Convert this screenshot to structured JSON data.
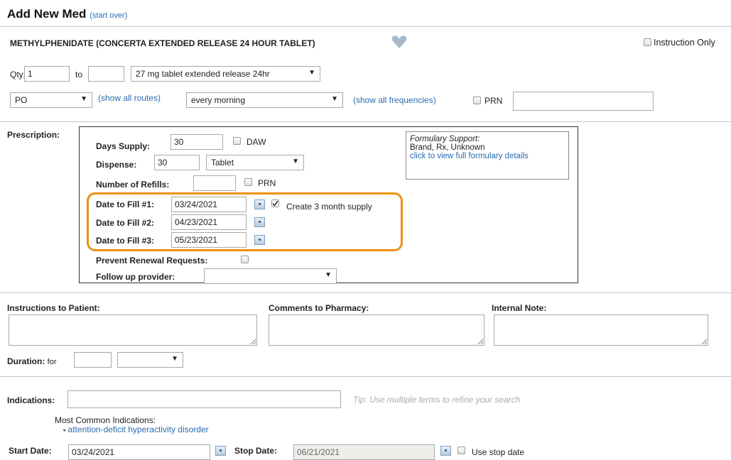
{
  "header": {
    "title": "Add New Med",
    "start_over": "(start over)"
  },
  "med": {
    "name": "METHYLPHENIDATE (CONCERTA EXTENDED RELEASE 24 HOUR TABLET)",
    "instruction_only": "Instruction Only"
  },
  "qty": {
    "label": "Qty:",
    "from": "1",
    "to_label": "to",
    "to": "",
    "form": "27 mg tablet extended release 24hr"
  },
  "route": {
    "value": "PO",
    "show_all_routes": "(show all routes)",
    "frequency": "every morning",
    "show_all_frequencies": "(show all frequencies)",
    "prn": "PRN",
    "prn_text": ""
  },
  "prescription": {
    "label": "Prescription:",
    "days_supply_label": "Days Supply:",
    "days_supply": "30",
    "daw": "DAW",
    "dispense_label": "Dispense:",
    "dispense": "30",
    "dispense_unit": "Tablet",
    "refills_label": "Number of Refills:",
    "refills": "",
    "prn": "PRN",
    "fill1_label": "Date to Fill #1:",
    "fill1": "03/24/2021",
    "fill2_label": "Date to Fill #2:",
    "fill2": "04/23/2021",
    "fill3_label": "Date to Fill #3:",
    "fill3": "05/23/2021",
    "three_month": "Create 3 month supply",
    "prevent_renewal": "Prevent Renewal Requests:",
    "follow_up": "Follow up provider:",
    "follow_up_value": ""
  },
  "formulary": {
    "title": "Formulary Support:",
    "info": "Brand, Rx, Unknown",
    "link": "click to view full formulary details"
  },
  "notes": {
    "instructions": "Instructions to Patient:",
    "comments": "Comments to Pharmacy:",
    "internal": "Internal Note:"
  },
  "duration": {
    "label": "Duration:",
    "for": "for",
    "value": "",
    "unit": ""
  },
  "indications": {
    "label": "Indications:",
    "value": "",
    "tip": "Tip: Use multiple terms to refine your search",
    "common_label": "Most Common Indications:",
    "common_item": "attention-deficit hyperactivity disorder"
  },
  "dates": {
    "start_label": "Start Date:",
    "start": "03/24/2021",
    "stop_label": "Stop Date:",
    "stop": "06/21/2021",
    "use_stop": "Use stop date"
  },
  "colors": {
    "highlight": "#f0900f",
    "link": "#2a6bb0"
  }
}
